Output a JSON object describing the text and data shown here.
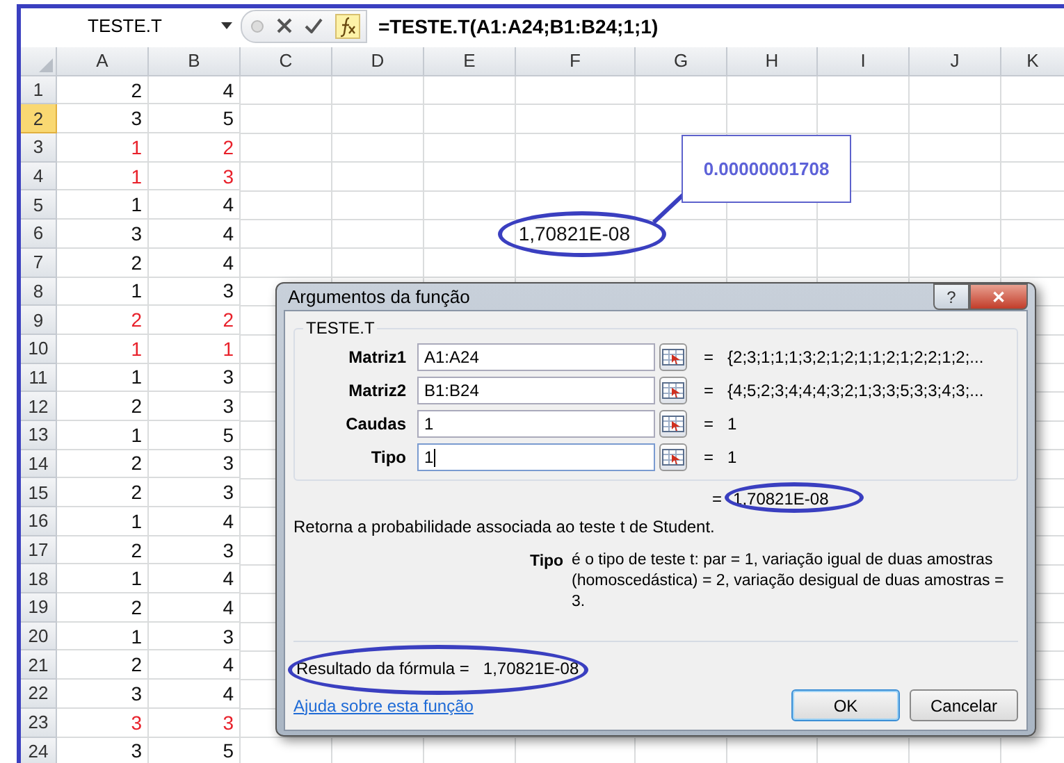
{
  "formula_bar": {
    "name_box": "TESTE.T",
    "formula": "=TESTE.T(A1:A24;B1:B24;1;1)"
  },
  "columns": [
    "A",
    "B",
    "C",
    "D",
    "E",
    "F",
    "G",
    "H",
    "I",
    "J",
    "K"
  ],
  "rows": [
    {
      "number": "1",
      "selected": false,
      "a": "2",
      "b": "4",
      "highlighted": false
    },
    {
      "number": "2",
      "selected": true,
      "a": "3",
      "b": "5",
      "highlighted": false
    },
    {
      "number": "3",
      "selected": false,
      "a": "1",
      "b": "2",
      "highlighted": true
    },
    {
      "number": "4",
      "selected": false,
      "a": "1",
      "b": "3",
      "highlighted": true
    },
    {
      "number": "5",
      "selected": false,
      "a": "1",
      "b": "4",
      "highlighted": false
    },
    {
      "number": "6",
      "selected": false,
      "a": "3",
      "b": "4",
      "highlighted": false,
      "f": "1,70821E-08"
    },
    {
      "number": "7",
      "selected": false,
      "a": "2",
      "b": "4",
      "highlighted": false
    },
    {
      "number": "8",
      "selected": false,
      "a": "1",
      "b": "3",
      "highlighted": false
    },
    {
      "number": "9",
      "selected": false,
      "a": "2",
      "b": "2",
      "highlighted": true
    },
    {
      "number": "10",
      "selected": false,
      "a": "1",
      "b": "1",
      "highlighted": true
    },
    {
      "number": "11",
      "selected": false,
      "a": "1",
      "b": "3",
      "highlighted": false
    },
    {
      "number": "12",
      "selected": false,
      "a": "2",
      "b": "3",
      "highlighted": false
    },
    {
      "number": "13",
      "selected": false,
      "a": "1",
      "b": "5",
      "highlighted": false
    },
    {
      "number": "14",
      "selected": false,
      "a": "2",
      "b": "3",
      "highlighted": false
    },
    {
      "number": "15",
      "selected": false,
      "a": "2",
      "b": "3",
      "highlighted": false
    },
    {
      "number": "16",
      "selected": false,
      "a": "1",
      "b": "4",
      "highlighted": false
    },
    {
      "number": "17",
      "selected": false,
      "a": "2",
      "b": "3",
      "highlighted": false
    },
    {
      "number": "18",
      "selected": false,
      "a": "1",
      "b": "4",
      "highlighted": false
    },
    {
      "number": "19",
      "selected": false,
      "a": "2",
      "b": "4",
      "highlighted": false
    },
    {
      "number": "20",
      "selected": false,
      "a": "1",
      "b": "3",
      "highlighted": false
    },
    {
      "number": "21",
      "selected": false,
      "a": "2",
      "b": "4",
      "highlighted": false
    },
    {
      "number": "22",
      "selected": false,
      "a": "3",
      "b": "4",
      "highlighted": false
    },
    {
      "number": "23",
      "selected": false,
      "a": "3",
      "b": "3",
      "highlighted": true
    },
    {
      "number": "24",
      "selected": false,
      "a": "3",
      "b": "5",
      "highlighted": false
    }
  ],
  "callout": {
    "text": "0.00000001708"
  },
  "dialog": {
    "title": "Argumentos da função",
    "help_button": "?",
    "close_button": "✕",
    "group_label": "TESTE.T",
    "arguments": [
      {
        "label": "Matriz1",
        "value": "A1:A24",
        "equals": "=",
        "result": "{2;3;1;1;1;3;2;1;2;1;1;2;1;2;2;1;2;...",
        "focused": false
      },
      {
        "label": "Matriz2",
        "value": "B1:B24",
        "equals": "=",
        "result": "{4;5;2;3;4;4;4;3;2;1;3;3;5;3;3;4;3;...",
        "focused": false
      },
      {
        "label": "Caudas",
        "value": "1",
        "equals": "=",
        "result": "1",
        "focused": false
      },
      {
        "label": "Tipo",
        "value": "1",
        "equals": "=",
        "result": "1",
        "focused": true
      }
    ],
    "formula_result": {
      "equals": "=",
      "value": "1,70821E-08"
    },
    "description": "Retorna a probabilidade associada ao teste t de Student.",
    "argument_help": {
      "name": "Tipo",
      "text": "é o tipo de teste t: par = 1, variação igual de duas amostras (homoscedástica) = 2, variação desigual de duas amostras = 3."
    },
    "result": {
      "label": "Resultado da fórmula =",
      "value": "1,70821E-08"
    },
    "help_link": "Ajuda sobre esta função",
    "buttons": [
      {
        "label": "OK",
        "default": true
      },
      {
        "label": "Cancelar",
        "default": false
      }
    ]
  }
}
